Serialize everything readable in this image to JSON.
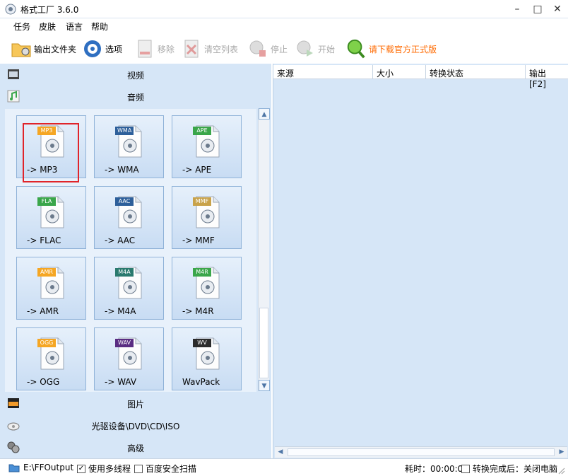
{
  "window": {
    "title": "格式工厂 3.6.0",
    "minimize": "–",
    "maximize": "□",
    "close": "✕"
  },
  "menu": [
    "任务",
    "皮肤",
    "语言",
    "帮助"
  ],
  "toolbar": {
    "output_folder": "输出文件夹",
    "options": "选项",
    "remove": "移除",
    "clear_list": "清空列表",
    "stop": "停止",
    "start": "开始",
    "promo": "请下载官方正式版"
  },
  "categories": {
    "video": "视频",
    "audio": "音频",
    "picture": "图片",
    "optical": "光驱设备\\DVD\\CD\\ISO",
    "advanced": "高级"
  },
  "tiles": [
    {
      "badge": "MP3",
      "label": "-> MP3",
      "color": "#f5a623"
    },
    {
      "badge": "WMA",
      "label": "-> WMA",
      "color": "#2d5f9a"
    },
    {
      "badge": "APE",
      "label": "-> APE",
      "color": "#3aa64a"
    },
    {
      "badge": "FLA",
      "label": "-> FLAC",
      "color": "#3aa64a"
    },
    {
      "badge": "AAC",
      "label": "-> AAC",
      "color": "#2d5f9a"
    },
    {
      "badge": "MMF",
      "label": "-> MMF",
      "color": "#c8a24a"
    },
    {
      "badge": "AMR",
      "label": "-> AMR",
      "color": "#f5a623"
    },
    {
      "badge": "M4A",
      "label": "-> M4A",
      "color": "#2a7a6e"
    },
    {
      "badge": "M4R",
      "label": "-> M4R",
      "color": "#3aa64a"
    },
    {
      "badge": "OGG",
      "label": "-> OGG",
      "color": "#f5a623"
    },
    {
      "badge": "WAV",
      "label": "-> WAV",
      "color": "#5a2d82"
    },
    {
      "badge": "WV",
      "label": "WavPack",
      "color": "#2b2b2b"
    }
  ],
  "task_table": {
    "columns": [
      "来源",
      "大小",
      "转换状态",
      "输出 [F2]"
    ]
  },
  "status": {
    "output_path": "E:\\FFOutput",
    "multithread": "使用多线程",
    "multithread_checked": true,
    "baidu_scan": "百度安全扫描",
    "baidu_checked": false,
    "elapsed": "耗时：00:00:00",
    "after_done": "转换完成后：关闭电脑",
    "after_done_checked": false
  }
}
